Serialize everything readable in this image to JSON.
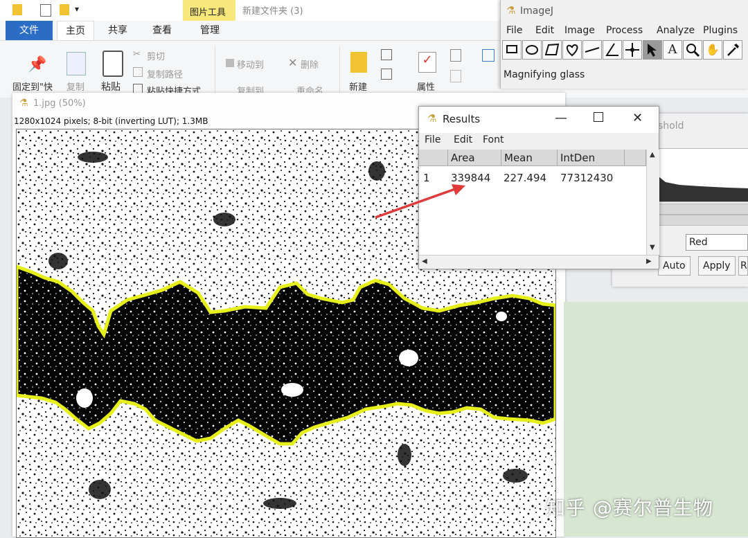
{
  "explorer": {
    "tool_context": "图片工具",
    "window_title": "新建文件夹 (3)",
    "tabs": [
      "文件",
      "主页",
      "共享",
      "查看",
      "管理"
    ],
    "ribbon": {
      "pin": "固定到\"快",
      "copy": "复制",
      "paste": "粘贴",
      "cut": "剪切",
      "copy_path": "复制路径",
      "paste_shortcut": "粘贴快捷方式",
      "move_to": "移动到",
      "copy_to": "复制到",
      "delete": "删除",
      "rename": "重命名",
      "new": "新建",
      "properties": "属性"
    }
  },
  "image_window": {
    "title": "1.jpg (50%)",
    "info": "1280x1024 pixels; 8-bit (inverting LUT); 1.3MB"
  },
  "imagej": {
    "title": "ImageJ",
    "menus": [
      "File",
      "Edit",
      "Image",
      "Process",
      "Analyze",
      "Plugins"
    ],
    "status": "Magnifying glass",
    "tools": [
      "rectangle-tool",
      "oval-tool",
      "polygon-tool",
      "freehand-tool",
      "line-tool",
      "angle-tool",
      "point-tool",
      "wand-tool",
      "text-tool",
      "magnifier-tool",
      "hand-tool",
      "dropper-tool"
    ]
  },
  "threshold": {
    "title": "shold",
    "select_value": "Red",
    "auto": "Auto",
    "apply": "Apply",
    "reset": "Re"
  },
  "results": {
    "title": "Results",
    "menus": [
      "File",
      "Edit",
      "Font"
    ],
    "columns": [
      "",
      "Area",
      "Mean",
      "IntDen"
    ],
    "rows": [
      [
        "1",
        "339844",
        "227.494",
        "77312430"
      ]
    ]
  },
  "watermark": "知乎 @赛尔普生物",
  "colors": {
    "accent_blue": "#2b6cc4",
    "tool_context": "#f8e77a",
    "outline_yellow": "#e6ef1a",
    "arrow_red": "#e03a3a"
  }
}
